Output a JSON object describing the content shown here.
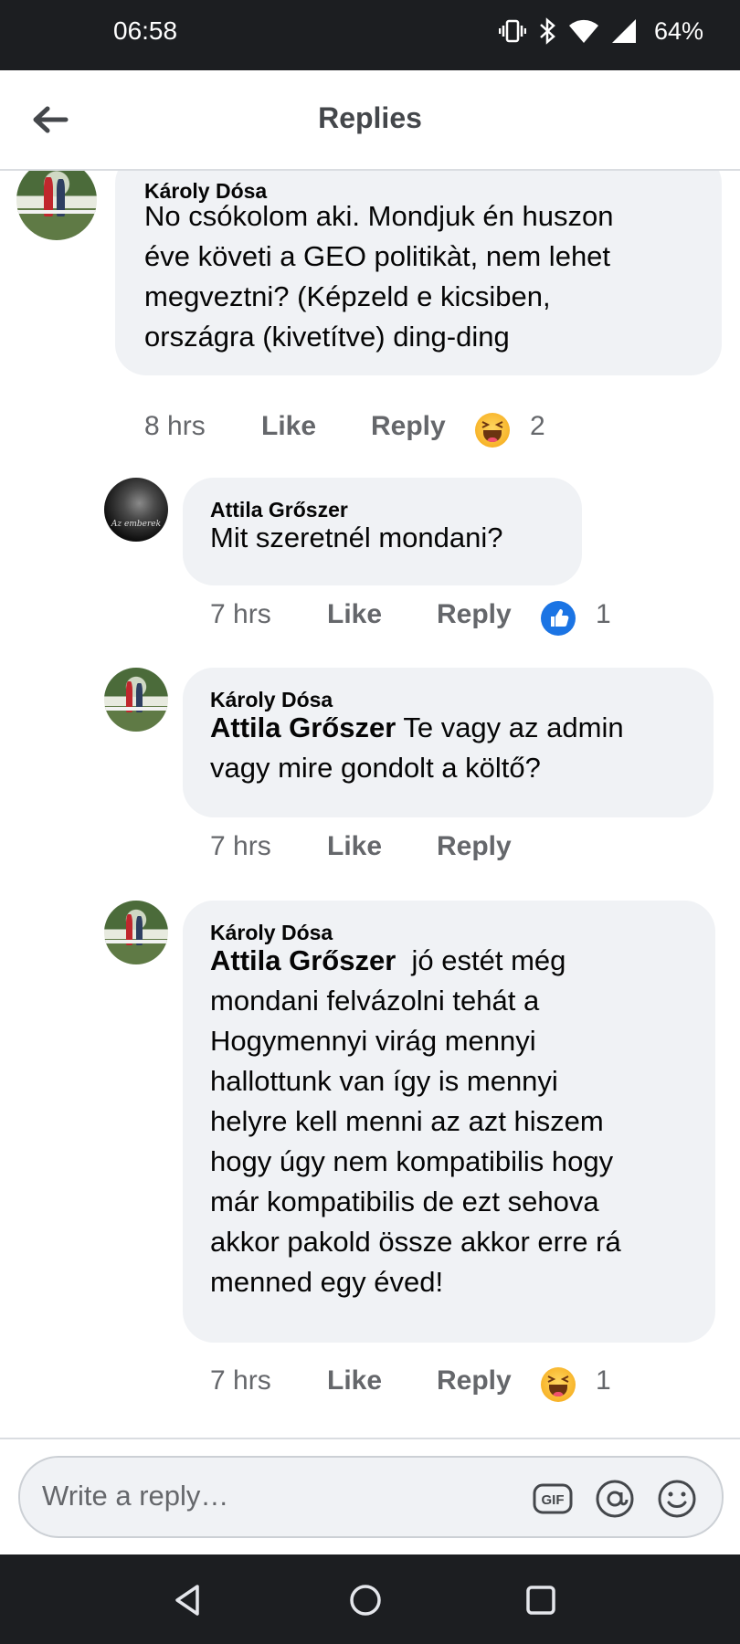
{
  "status_bar": {
    "time": "06:58",
    "battery": "64%"
  },
  "header": {
    "title": "Replies"
  },
  "comments": [
    {
      "author": "Károly Dósa",
      "mention": "",
      "lines": [
        "No csókolom aki. Mondjuk én huszon",
        "éve követi  a GEO politikàt, nem lehet",
        "megveztni? (Képzeld e kicsiben,",
        "országra (kivetítve) ding-ding"
      ],
      "time": "8 hrs",
      "like": "Like",
      "reply": "Reply",
      "reaction": "haha",
      "reaction_count": "2"
    },
    {
      "author": "Attila Grőszer",
      "mention": "",
      "lines": [
        "Mit szeretnél mondani?"
      ],
      "time": "7 hrs",
      "like": "Like",
      "reply": "Reply",
      "reaction": "like",
      "reaction_count": "1",
      "avatar_caption": "Az emberek"
    },
    {
      "author": "Károly Dósa",
      "mention": "Attila Grőszer",
      "lines": [
        " Te vagy az admin",
        "vagy mire gondolt a költő?"
      ],
      "time": "7 hrs",
      "like": "Like",
      "reply": "Reply",
      "reaction": "",
      "reaction_count": ""
    },
    {
      "author": "Károly Dósa",
      "mention": "Attila Grőszer",
      "lines": [
        "  jó estét még",
        "mondani felvázolni tehát a",
        "Hogymennyi virág mennyi",
        "hallottunk van így is mennyi",
        "helyre kell menni az azt hiszem",
        "hogy úgy nem kompatibilis hogy",
        "már kompatibilis de ezt sehova",
        "akkor pakold össze akkor erre rá",
        "menned egy éved!"
      ],
      "time": "7 hrs",
      "like": "Like",
      "reply": "Reply",
      "reaction": "haha",
      "reaction_count": "1"
    }
  ],
  "reply_bar": {
    "placeholder": "Write a reply…",
    "gif_label": "GIF"
  }
}
